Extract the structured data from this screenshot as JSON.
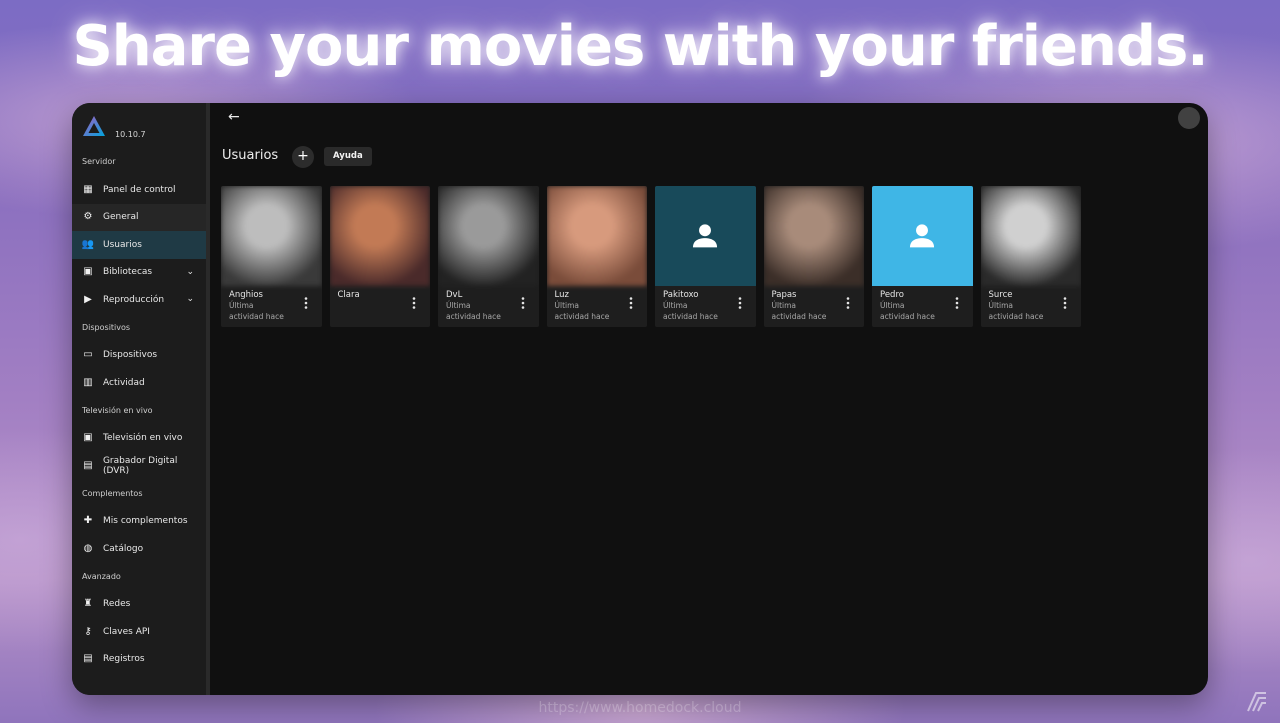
{
  "headline": "Share your movies with your friends.",
  "app": {
    "version": "10.10.7",
    "accent": "#1f3a45"
  },
  "sidebar": {
    "sections": [
      {
        "title": "Servidor",
        "items": [
          {
            "label": "Panel de control",
            "icon": "dashboard-icon"
          },
          {
            "label": "General",
            "icon": "gear-icon"
          },
          {
            "label": "Usuarios",
            "icon": "people-icon",
            "active": true
          },
          {
            "label": "Bibliotecas",
            "icon": "library-icon",
            "expandable": true
          },
          {
            "label": "Reproducción",
            "icon": "play-circle-icon",
            "expandable": true
          }
        ]
      },
      {
        "title": "Dispositivos",
        "items": [
          {
            "label": "Dispositivos",
            "icon": "devices-icon"
          },
          {
            "label": "Actividad",
            "icon": "activity-icon"
          }
        ]
      },
      {
        "title": "Televisión en vivo",
        "items": [
          {
            "label": "Televisión en vivo",
            "icon": "live-tv-icon"
          },
          {
            "label": "Grabador Digital (DVR)",
            "icon": "dvr-icon"
          }
        ]
      },
      {
        "title": "Complementos",
        "items": [
          {
            "label": "Mis complementos",
            "icon": "puzzle-icon"
          },
          {
            "label": "Catálogo",
            "icon": "globe-icon"
          }
        ]
      },
      {
        "title": "Avanzado",
        "items": [
          {
            "label": "Redes",
            "icon": "network-icon"
          },
          {
            "label": "Claves API",
            "icon": "key-icon"
          },
          {
            "label": "Registros",
            "icon": "logs-icon"
          }
        ]
      }
    ]
  },
  "main": {
    "title": "Usuarios",
    "help_label": "Ayuda",
    "users": [
      {
        "name": "Anghios",
        "line1": "Última",
        "line2": "actividad hace",
        "avatar": "photo",
        "tone": [
          "#bdbdbd",
          "#3a3a3a"
        ]
      },
      {
        "name": "Clara",
        "line1": "",
        "line2": "",
        "avatar": "photo",
        "tone": [
          "#c27a55",
          "#4a2a2a"
        ]
      },
      {
        "name": "DvL",
        "line1": "Última",
        "line2": "actividad hace",
        "avatar": "photo",
        "tone": [
          "#9a9a9a",
          "#222222"
        ]
      },
      {
        "name": "Luz",
        "line1": "Última",
        "line2": "actividad hace",
        "avatar": "photo",
        "tone": [
          "#d79a7d",
          "#7a4c3a"
        ]
      },
      {
        "name": "Pakitoxo",
        "line1": "Última",
        "line2": "actividad hace",
        "avatar": "placeholder",
        "tone": [
          "#184a5a",
          "#184a5a"
        ]
      },
      {
        "name": "Papas",
        "line1": "Última",
        "line2": "actividad hace",
        "avatar": "photo",
        "tone": [
          "#a88b7a",
          "#3b2e28"
        ]
      },
      {
        "name": "Pedro",
        "line1": "Última",
        "line2": "actividad hace",
        "avatar": "placeholder",
        "tone": [
          "#3fb6e6",
          "#3fb6e6"
        ]
      },
      {
        "name": "Surce",
        "line1": "Última",
        "line2": "actividad hace",
        "avatar": "photo",
        "tone": [
          "#d0d0d0",
          "#2a2a2a"
        ]
      }
    ]
  },
  "footer": {
    "watermark": "https://www.homedock.cloud"
  }
}
